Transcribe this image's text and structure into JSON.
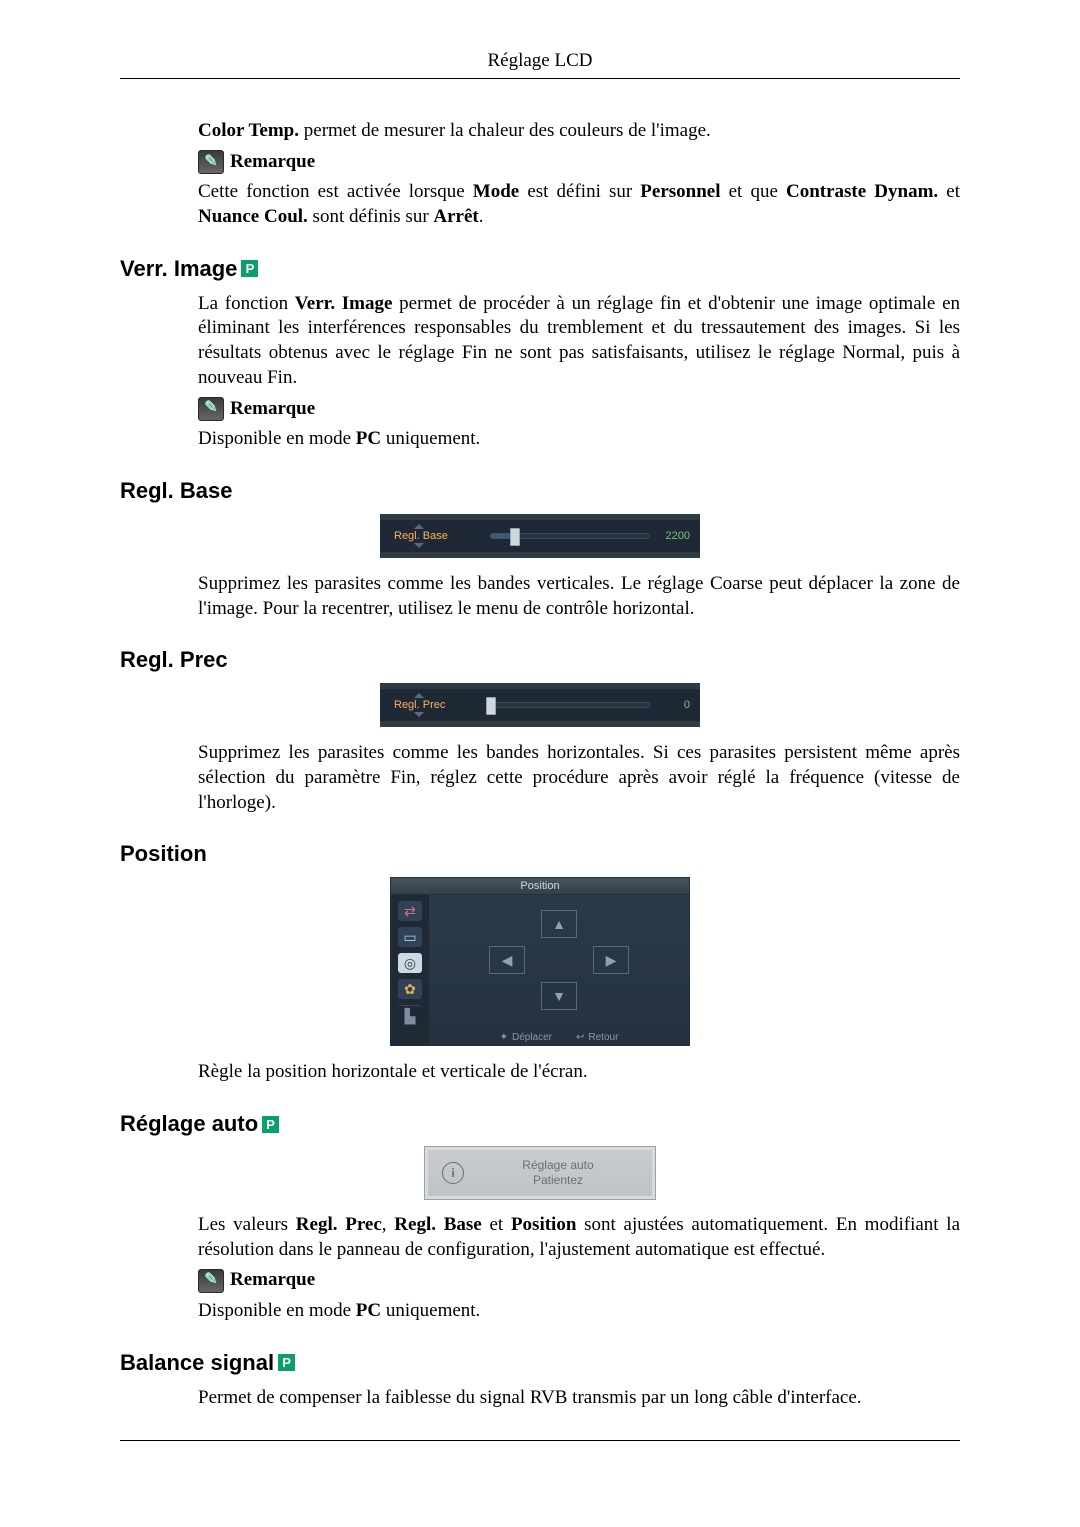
{
  "header": {
    "title": "Réglage LCD"
  },
  "intro": {
    "color_temp_line_html": "<b>Color Temp.</b> permet de mesurer la chaleur des couleurs de l'image.",
    "note_label": "Remarque",
    "note_body_html": "Cette fonction est activée lorsque <b>Mode</b> est défini sur <b>Personnel</b> et que <b>Contraste Dynam.</b> et <b>Nuance Coul.</b> sont définis sur <b>Arrêt</b>."
  },
  "verr_image": {
    "heading": "Verr. Image",
    "badge": "P",
    "body_html": "La fonction <b>Verr. Image</b> permet de procéder à un réglage fin et d'obtenir une image optimale en éliminant les interférences responsables du tremblement et du tressautement des images. Si les résultats obtenus avec le réglage Fin ne sont pas satisfaisants, utilisez le réglage Normal, puis à nouveau Fin.",
    "note_label": "Remarque",
    "note_body_html": "Disponible en mode <b>PC</b> uniquement."
  },
  "regl_base": {
    "heading": "Regl. Base",
    "slider_label": "Regl. Base",
    "slider_value": "2200",
    "slider_fill_pct": 15,
    "body": "Supprimez les parasites comme les bandes verticales. Le réglage Coarse peut déplacer la zone de l'image. Pour la recentrer, utilisez le menu de contrôle horizontal."
  },
  "regl_prec": {
    "heading": "Regl. Prec",
    "slider_label": "Regl. Prec",
    "slider_value": "0",
    "slider_fill_pct": 0,
    "body": "Supprimez les parasites comme les bandes horizontales. Si ces parasites persistent même après sélection du paramètre Fin, réglez cette procédure après avoir réglé la fréquence (vitesse de l'horloge)."
  },
  "position": {
    "heading": "Position",
    "menu_title": "Position",
    "footer_move": "Déplacer",
    "footer_return": "Retour",
    "body": "Règle la position horizontale et verticale de l'écran."
  },
  "reglage_auto": {
    "heading": "Réglage auto",
    "badge": "P",
    "popup_line1": "Réglage auto",
    "popup_line2": "Patientez",
    "body_html": "Les valeurs <b>Regl. Prec</b>, <b>Regl. Base</b> et <b>Position</b> sont ajustées automatiquement. En modifiant la résolution dans le panneau de configuration, l'ajustement automatique est effectué.",
    "note_label": "Remarque",
    "note_body_html": "Disponible en mode <b>PC</b> uniquement."
  },
  "balance_signal": {
    "heading": "Balance signal",
    "badge": "P",
    "body": "Permet de compenser la faiblesse du signal RVB transmis par un long câble d'interface."
  }
}
